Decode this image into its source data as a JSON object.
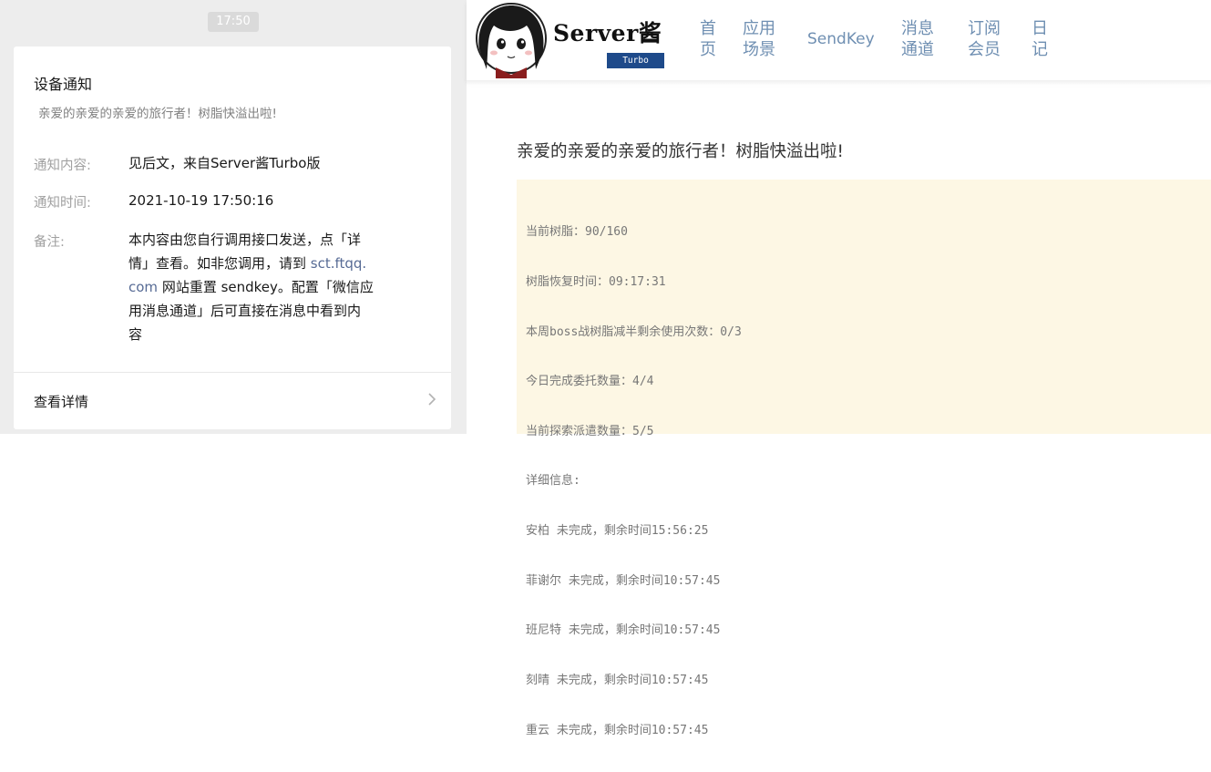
{
  "wechat": {
    "timestamp": "17:50",
    "card": {
      "title": "设备通知",
      "subtitle": "亲爱的亲爱的亲爱的旅行者！树脂快溢出啦!",
      "rows": [
        {
          "label": "通知内容:",
          "value": "见后文，来自Server酱Turbo版"
        },
        {
          "label": "通知时间:",
          "value": "2021-10-19 17:50:16"
        }
      ],
      "note": {
        "label": "备注:",
        "lines": [
          "本内容由您自行调用接口发送，点「详",
          "情」查看。如非您调用，请到",
          " sct.ftqq.",
          "com",
          " 网站重置 sendkey。配置「微信应",
          "用消息通道」后可直接在消息中看到内",
          "容"
        ]
      },
      "detail_label": "查看详情"
    }
  },
  "site": {
    "brand": "Server酱",
    "badge": "Turbo",
    "nav": [
      {
        "l1": "首",
        "l2": "页"
      },
      {
        "l1": "应用",
        "l2": "场景"
      },
      {
        "single": "SendKey"
      },
      {
        "l1": "消息",
        "l2": "通道"
      },
      {
        "l1": "订阅",
        "l2": "会员"
      },
      {
        "l1": "日",
        "l2": "记"
      }
    ],
    "message_title": "亲爱的亲爱的亲爱的旅行者！树脂快溢出啦!",
    "message_lines": [
      "当前树脂：90/160",
      "树脂恢复时间：09:17:31",
      "本周boss战树脂减半剩余使用次数：0/3",
      "今日完成委托数量：4/4",
      "当前探索派遣数量：5/5",
      "详细信息:",
      "安柏 未完成，剩余时间15:56:25",
      "菲谢尔 未完成，剩余时间10:57:45",
      "班尼特 未完成，剩余时间10:57:45",
      "刻晴 未完成，剩余时间10:57:45",
      "重云 未完成，剩余时间10:57:45"
    ]
  },
  "colors": {
    "link": "#576b95",
    "nav": "#6f8fb2",
    "badge": "#1e4a8a",
    "message_bg": "#fdf7e4"
  }
}
